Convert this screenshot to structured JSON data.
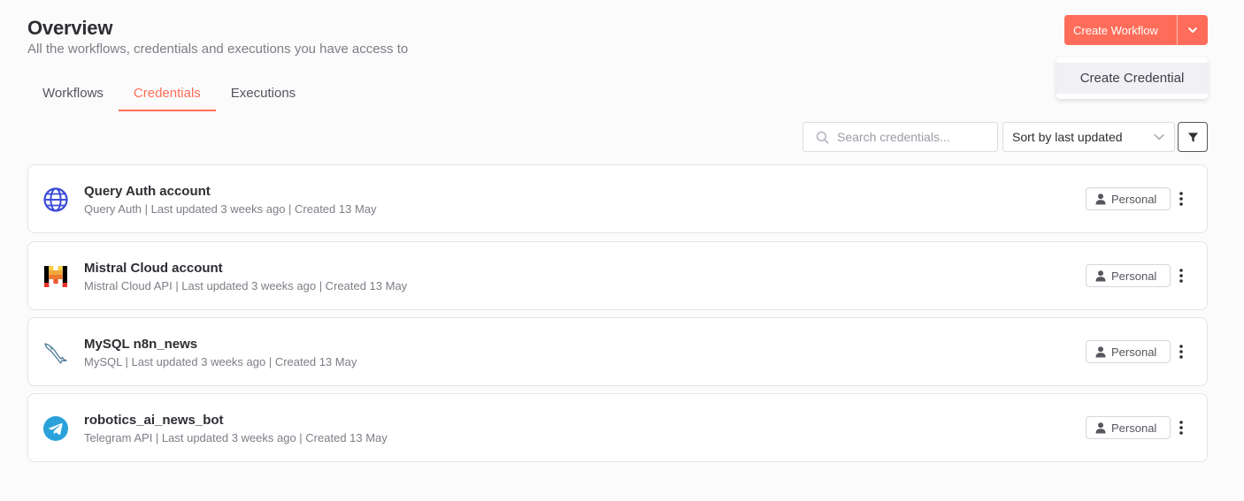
{
  "header": {
    "title": "Overview",
    "subtitle": "All the workflows, credentials and executions you have access to"
  },
  "tabs": [
    {
      "label": "Workflows",
      "active": false
    },
    {
      "label": "Credentials",
      "active": true
    },
    {
      "label": "Executions",
      "active": false
    }
  ],
  "actions": {
    "create_workflow_label": "Create Workflow",
    "dropdown_item_label": "Create Credential"
  },
  "toolbar": {
    "search_placeholder": "Search credentials...",
    "sort_label": "Sort by last updated",
    "filter_icon": "filter-icon"
  },
  "credentials": [
    {
      "title": "Query Auth account",
      "meta": "Query Auth | Last updated 3 weeks ago | Created 13 May",
      "badge": "Personal",
      "icon": "globe-icon"
    },
    {
      "title": "Mistral Cloud account",
      "meta": "Mistral Cloud API | Last updated 3 weeks ago | Created 13 May",
      "badge": "Personal",
      "icon": "mistral-logo-icon"
    },
    {
      "title": "MySQL n8n_news",
      "meta": "MySQL | Last updated 3 weeks ago | Created 13 May",
      "badge": "Personal",
      "icon": "mysql-dolphin-icon"
    },
    {
      "title": "robotics_ai_news_bot",
      "meta": "Telegram API | Last updated 3 weeks ago | Created 13 May",
      "badge": "Personal",
      "icon": "telegram-icon"
    }
  ],
  "colors": {
    "accent": "#ff6d5a",
    "text": "#2d2e33",
    "muted": "#7d7d87",
    "border": "#e3e4e8",
    "background": "#fbfbfb"
  }
}
